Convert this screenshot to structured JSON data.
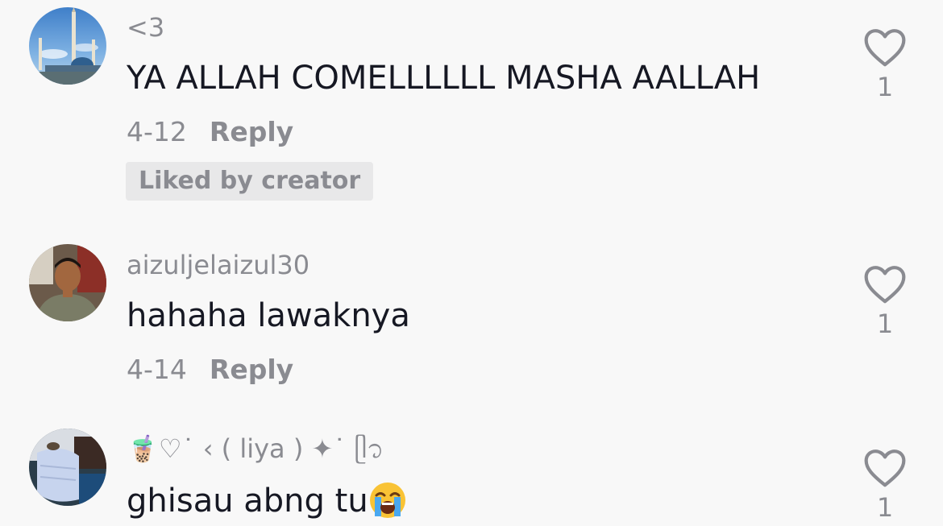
{
  "comments": [
    {
      "username": "<3",
      "text": "YA ALLAH COMELLLLLL MASHA AALLAH",
      "date": "4-12",
      "reply_label": "Reply",
      "badge": "Liked by creator",
      "likes": "1",
      "avatar_icon": "mosque-photo-avatar"
    },
    {
      "username": "aizuljelaizul30",
      "text": "hahaha lawaknya",
      "date": "4-14",
      "reply_label": "Reply",
      "likes": "1",
      "avatar_icon": "man-photo-avatar"
    },
    {
      "username": "🧋♡˙ ‹ ( liya ) ✦˙ ᥫ᭡",
      "text": "ghisau abng tu",
      "text_emoji": "loudly-crying-face",
      "likes": "1",
      "avatar_icon": "face-mask-photo-avatar"
    }
  ],
  "colors": {
    "background": "#f8f8f8",
    "primary_text": "#161823",
    "secondary_text": "#8a8b91",
    "badge_bg": "#e8e8e9"
  },
  "icons": {
    "like": "heart-outline-icon"
  }
}
